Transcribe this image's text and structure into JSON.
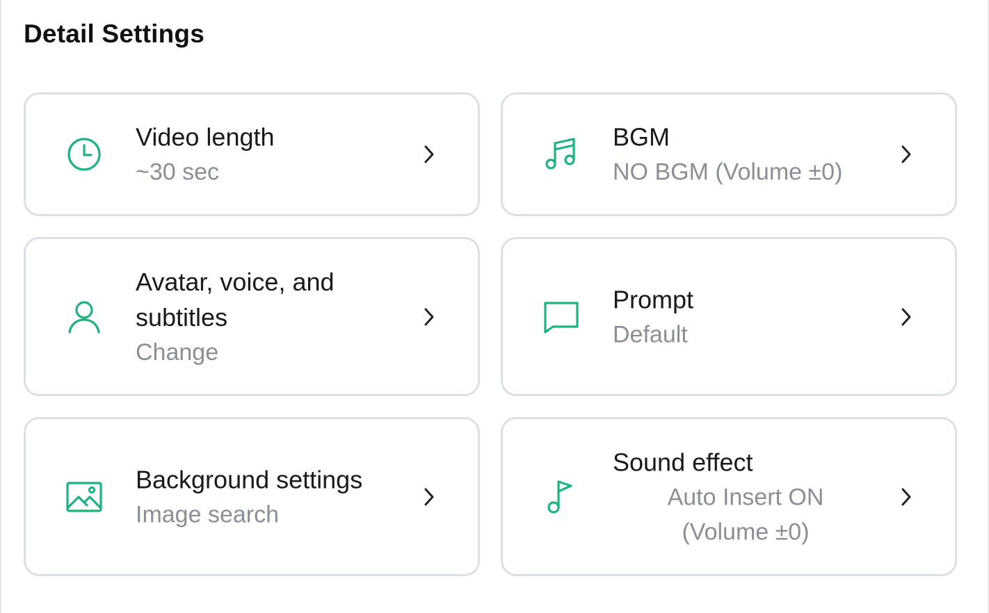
{
  "page": {
    "title": "Detail Settings"
  },
  "colors": {
    "accent": "#1db37f",
    "border": "#dcdfe3",
    "label": "#1a1a1a",
    "value": "#8a8f96"
  },
  "cards": {
    "video_length": {
      "icon": "clock-icon",
      "label": "Video length",
      "value": "~30 sec"
    },
    "bgm": {
      "icon": "music-notes-icon",
      "label": "BGM",
      "value": "NO BGM (Volume ±0)"
    },
    "avatar": {
      "icon": "user-icon",
      "label": "Avatar, voice, and subtitles",
      "value": "Change"
    },
    "prompt": {
      "icon": "speech-bubble-icon",
      "label": "Prompt",
      "value": "Default"
    },
    "background": {
      "icon": "image-icon",
      "label": "Background settings",
      "value": "Image search"
    },
    "sound_effect": {
      "icon": "music-note-icon",
      "label": "Sound effect",
      "value_line1": "Auto Insert ON",
      "value_line2": "(Volume ±0)"
    }
  }
}
